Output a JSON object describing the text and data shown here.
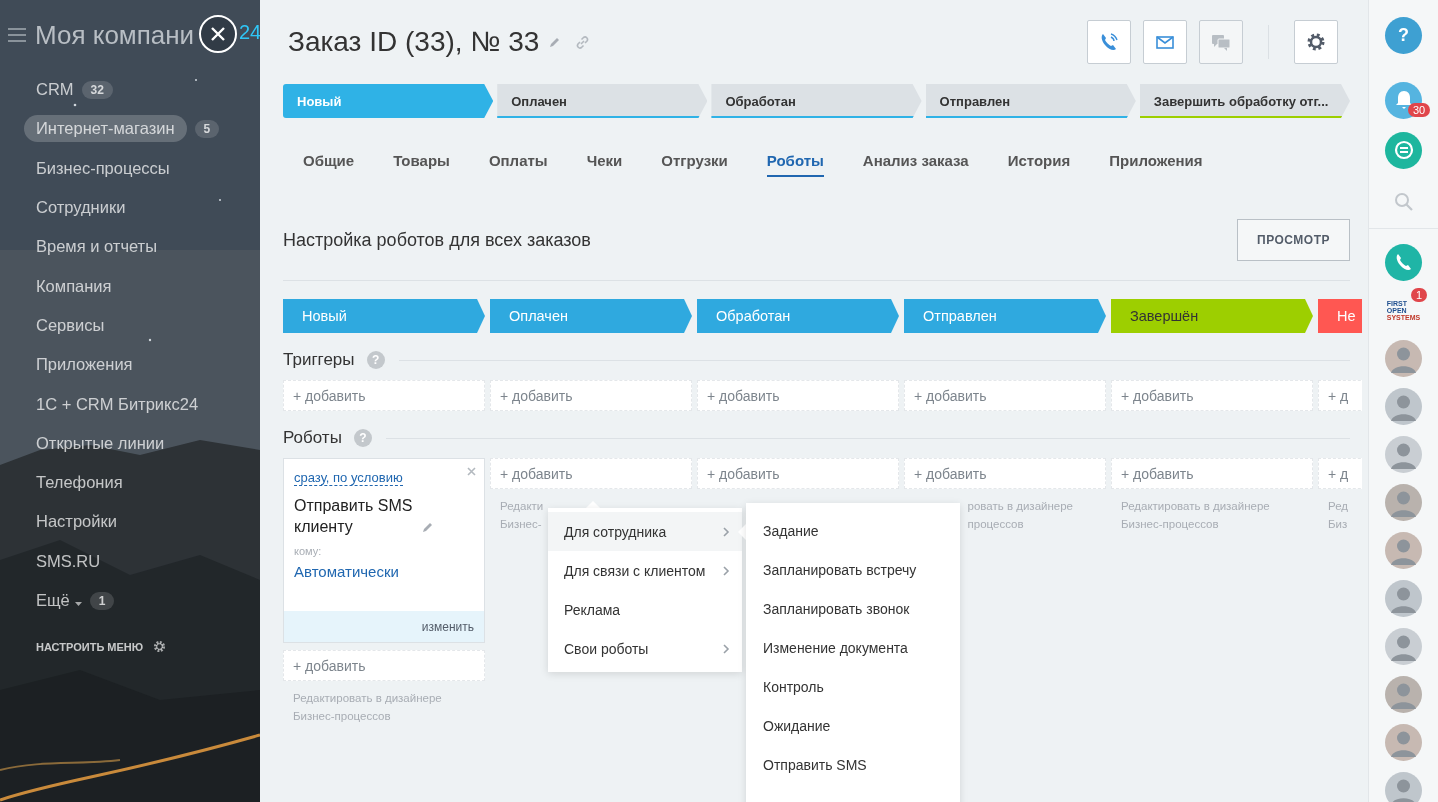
{
  "sidebar": {
    "title": "Моя компани",
    "title_suffix": "24",
    "items": [
      {
        "label": "CRM",
        "counter": "32",
        "selected": false,
        "dropdown": false
      },
      {
        "label": "Интернет-магазин",
        "counter": "5",
        "selected": true,
        "dropdown": false
      },
      {
        "label": "Бизнес-процессы",
        "selected": false,
        "dropdown": false
      },
      {
        "label": "Сотрудники",
        "selected": false,
        "dropdown": false
      },
      {
        "label": "Время и отчеты",
        "selected": false,
        "dropdown": false
      },
      {
        "label": "Компания",
        "selected": false,
        "dropdown": false
      },
      {
        "label": "Сервисы",
        "selected": false,
        "dropdown": false
      },
      {
        "label": "Приложения",
        "selected": false,
        "dropdown": false
      },
      {
        "label": "1С + CRM Битрикс24",
        "selected": false,
        "dropdown": false
      },
      {
        "label": "Открытые линии",
        "selected": false,
        "dropdown": false
      },
      {
        "label": "Телефония",
        "selected": false,
        "dropdown": false
      },
      {
        "label": "Настройки",
        "selected": false,
        "dropdown": false
      },
      {
        "label": "SMS.RU",
        "selected": false,
        "dropdown": false
      },
      {
        "label": "Ещё",
        "counter": "1",
        "selected": false,
        "dropdown": true
      }
    ],
    "configure": "НАСТРОИТЬ МЕНЮ"
  },
  "header": {
    "title": "Заказ ID (33), № 33",
    "actions": [
      {
        "kind": "phone",
        "disabled": false
      },
      {
        "kind": "mail",
        "disabled": false
      },
      {
        "kind": "chat",
        "disabled": true
      }
    ]
  },
  "order_stages": [
    {
      "label": "Новый",
      "selected": true,
      "color": "#2fb2e6"
    },
    {
      "label": "Оплачен",
      "selected": false,
      "color": "#2fb2e6"
    },
    {
      "label": "Обработан",
      "selected": false,
      "color": "#2fb2e6"
    },
    {
      "label": "Отправлен",
      "selected": false,
      "color": "#2fb2e6"
    },
    {
      "label": "Завершить обработку отг...",
      "selected": false,
      "color": "#9dcf00"
    }
  ],
  "tabs": [
    {
      "label": "Общие",
      "selected": false
    },
    {
      "label": "Товары",
      "selected": false
    },
    {
      "label": "Оплаты",
      "selected": false
    },
    {
      "label": "Чеки",
      "selected": false
    },
    {
      "label": "Отгрузки",
      "selected": false
    },
    {
      "label": "Роботы",
      "selected": true
    },
    {
      "label": "Анализ заказа",
      "selected": false
    },
    {
      "label": "История",
      "selected": false
    },
    {
      "label": "Приложения",
      "selected": false
    }
  ],
  "robots_settings": {
    "title": "Настройка роботов для всех заказов",
    "preview_button": "ПРОСМОТР",
    "stages": [
      {
        "label": "Новый",
        "color": "#2fa9df"
      },
      {
        "label": "Оплачен",
        "color": "#2fa9df"
      },
      {
        "label": "Обработан",
        "color": "#2fa9df"
      },
      {
        "label": "Отправлен",
        "color": "#2fa9df"
      },
      {
        "label": "Завершён",
        "color": "#9dcf00"
      },
      {
        "label": "Не",
        "color": "#ff5752"
      }
    ],
    "triggers_heading": {
      "label": "Триггеры",
      "hint": "?"
    },
    "triggers": [
      "+ добавить",
      "+ добавить",
      "+ добавить",
      "+ добавить",
      "+ добавить",
      "+ д"
    ],
    "robots_heading": {
      "label": "Роботы",
      "hint": "?"
    },
    "robot_columns": [
      {
        "robot": {
          "condition": "сразу, по условию",
          "title": "Отправить SMS клиенту",
          "recipient_label": "кому:",
          "recipient": "Автоматически",
          "edit": "изменить"
        },
        "add": "+ добавить",
        "note": [
          "Редактировать в дизайнере",
          "Бизнес-процессов"
        ],
        "note_clipped": false
      },
      {
        "add": "+ добавить",
        "note": [
          "Редакти",
          "Бизнес-"
        ],
        "note_clipped": false
      },
      {
        "add": "+ добавить"
      },
      {
        "add": "+ добавить",
        "note": [
          "ровать в дизайнере",
          "процессов"
        ],
        "note_clipped": true
      },
      {
        "add": "+ добавить",
        "note": [
          "Редактировать в дизайнере",
          "Бизнес-процессов"
        ],
        "note_clipped": false
      },
      {
        "add": "+ д",
        "note": [
          "Ред",
          "Биз"
        ],
        "note_clipped": false
      }
    ],
    "menu": {
      "items": [
        {
          "label": "Для сотрудника",
          "has_submenu": true,
          "selected": true
        },
        {
          "label": "Для связи с клиентом",
          "has_submenu": true,
          "selected": false
        },
        {
          "label": "Реклама",
          "has_submenu": false,
          "selected": false
        },
        {
          "label": "Свои роботы",
          "has_submenu": true,
          "selected": false
        }
      ],
      "submenu": [
        "Задание",
        "Запланировать встречу",
        "Запланировать звонок",
        "Изменение документа",
        "Контроль",
        "Ожидание",
        "Отправить SMS"
      ]
    }
  },
  "right_bar": [
    {
      "kind": "help",
      "label": "?"
    },
    {
      "kind": "bell",
      "badge": "30"
    },
    {
      "kind": "chat"
    },
    {
      "kind": "search"
    },
    {
      "kind": "phone"
    },
    {
      "kind": "logo",
      "lines": [
        "FIRST",
        "OPEN",
        "SYSTEMS"
      ],
      "badge": "1"
    },
    {
      "kind": "avatar"
    },
    {
      "kind": "avatar"
    },
    {
      "kind": "avatar"
    },
    {
      "kind": "avatar"
    },
    {
      "kind": "avatar"
    },
    {
      "kind": "avatar"
    },
    {
      "kind": "avatar"
    },
    {
      "kind": "avatar"
    },
    {
      "kind": "avatar"
    },
    {
      "kind": "avatar"
    }
  ]
}
